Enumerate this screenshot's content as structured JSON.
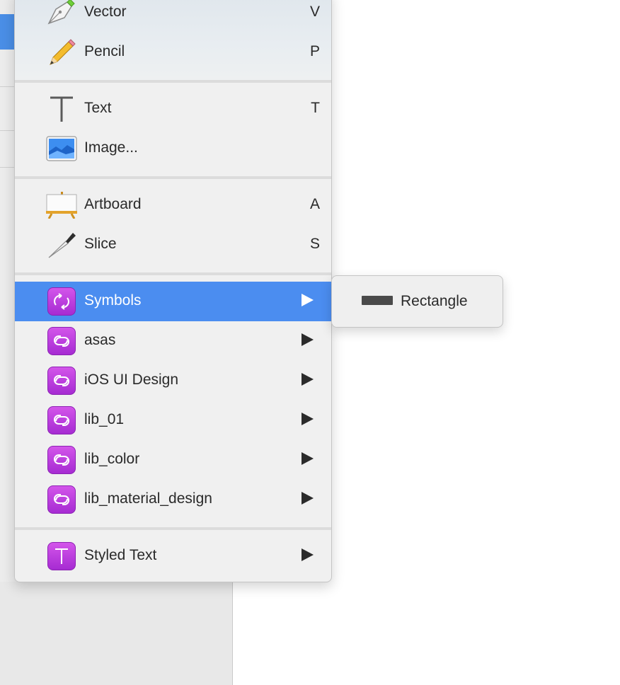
{
  "menu": {
    "items": [
      {
        "label": "Vector",
        "shortcut": "V",
        "icon": "vector-pen-icon"
      },
      {
        "label": "Pencil",
        "shortcut": "P",
        "icon": "pencil-icon"
      },
      {
        "label": "Text",
        "shortcut": "T",
        "icon": "text-tool-icon"
      },
      {
        "label": "Image...",
        "shortcut": "",
        "icon": "image-icon"
      },
      {
        "label": "Artboard",
        "shortcut": "A",
        "icon": "artboard-easel-icon"
      },
      {
        "label": "Slice",
        "shortcut": "S",
        "icon": "slice-knife-icon"
      },
      {
        "label": "Symbols",
        "shortcut": "",
        "icon": "symbols-icon",
        "submenu": true,
        "active": true
      },
      {
        "label": "asas",
        "icon": "library-icon",
        "submenu": true
      },
      {
        "label": "iOS UI Design",
        "icon": "library-icon",
        "submenu": true
      },
      {
        "label": "lib_01",
        "icon": "library-icon",
        "submenu": true
      },
      {
        "label": "lib_color",
        "icon": "library-icon",
        "submenu": true
      },
      {
        "label": "lib_material_design",
        "icon": "library-icon",
        "submenu": true
      },
      {
        "label": "Styled Text",
        "icon": "styled-text-icon",
        "submenu": true
      }
    ]
  },
  "submenu": {
    "items": [
      {
        "label": "Rectangle",
        "icon": "rectangle-symbol-icon"
      }
    ]
  },
  "colors": {
    "highlight": "#4b8df0",
    "symbol_purple": "#b83ddc"
  }
}
